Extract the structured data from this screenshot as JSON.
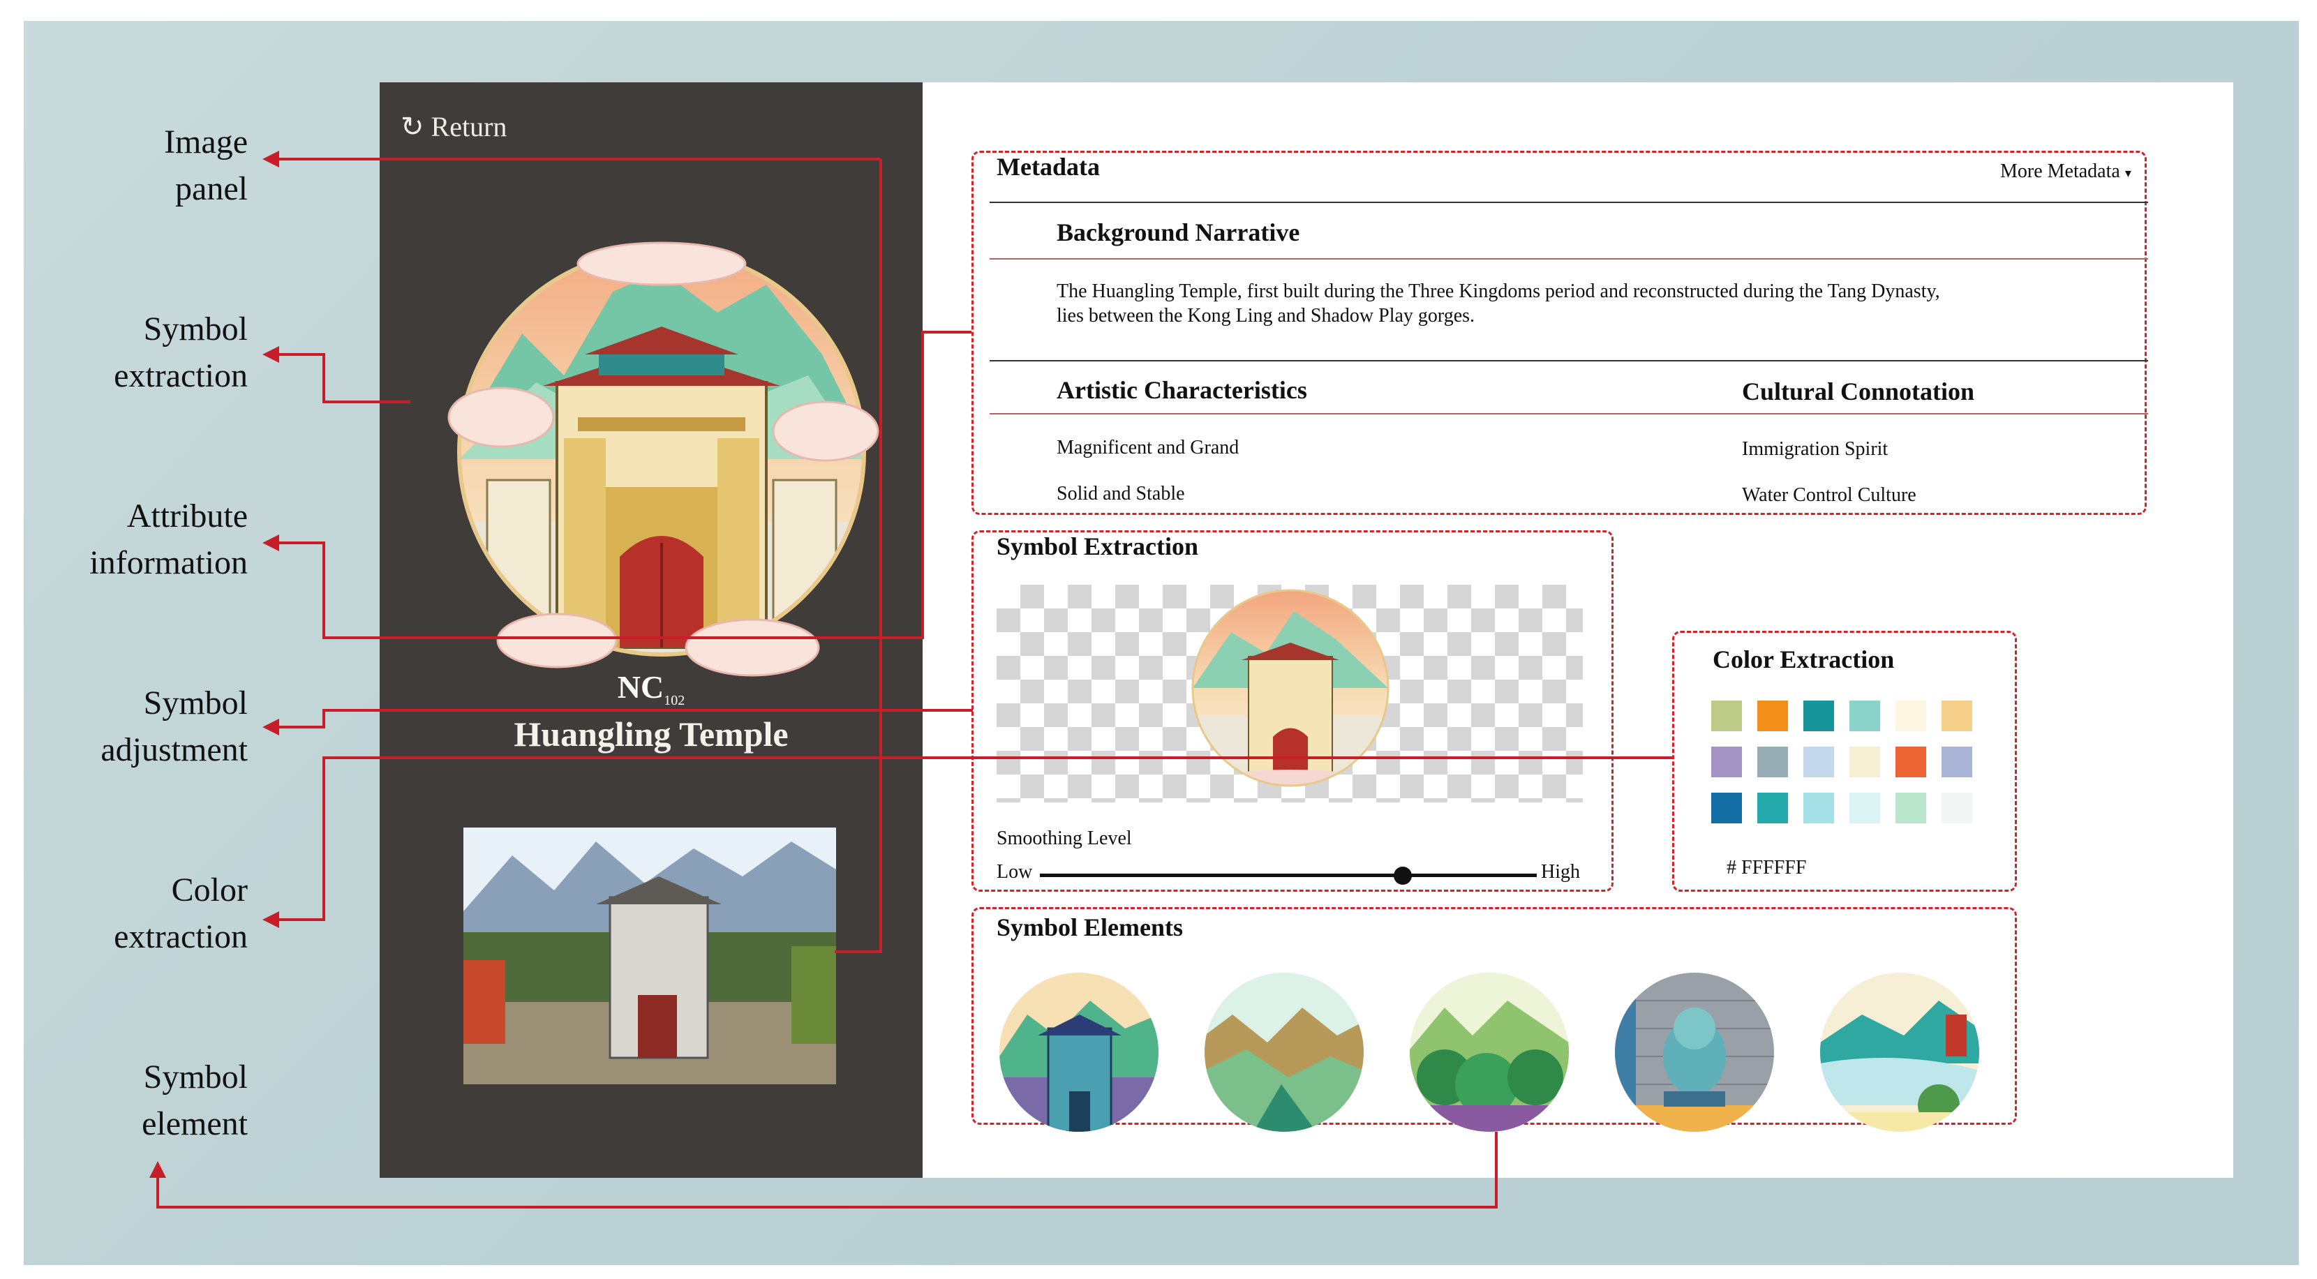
{
  "callouts": {
    "image_panel": [
      "Image",
      "panel"
    ],
    "symbol_extraction": [
      "Symbol",
      "extraction"
    ],
    "attribute_information": [
      "Attribute",
      "information"
    ],
    "symbol_adjustment": [
      "Symbol",
      "adjustment"
    ],
    "color_extraction": [
      "Color",
      "extraction"
    ],
    "symbol_element": [
      "Symbol",
      "element"
    ]
  },
  "left_panel": {
    "return_label": "Return",
    "code_main": "NC",
    "code_sub": "102",
    "name": "Huangling Temple"
  },
  "metadata": {
    "title": "Metadata",
    "more": "More Metadata",
    "background_title": "Background Narrative",
    "background_line1": "The Huangling Temple, first built during the Three Kingdoms period and reconstructed during the Tang Dynasty,",
    "background_line2": "lies between the Kong Ling and Shadow Play gorges.",
    "artistic_title": "Artistic Characteristics",
    "artistic_items": [
      "Magnificent and Grand",
      "Solid and Stable"
    ],
    "cultural_title": "Cultural Connotation",
    "cultural_items": [
      "Immigration Spirit",
      "Water Control Culture"
    ]
  },
  "symbol_extraction": {
    "title": "Symbol Extraction",
    "smoothing_label": "Smoothing Level",
    "low": "Low",
    "high": "High",
    "smoothing_value": 0.73
  },
  "color_extraction": {
    "title": "Color Extraction",
    "palette": [
      [
        "#bccc87",
        "#f28e1a",
        "#17959a",
        "#8ad3c8",
        "#fdf7e1",
        "#f6cf8a"
      ],
      [
        "#a494c6",
        "#97aeb6",
        "#c6d9ec",
        "#f5efd3",
        "#ec6434",
        "#a9b4d6"
      ],
      [
        "#126da4",
        "#24aaaa",
        "#a5e0e6",
        "#dcf3f3",
        "#b9e6cc",
        "#f2f7f6"
      ]
    ],
    "hex_value": "# FFFFFF"
  },
  "symbol_elements": {
    "title": "Symbol Elements",
    "items": [
      "temple-gate",
      "canyon",
      "forest",
      "guardian-lion",
      "river"
    ]
  },
  "colors": {
    "accent_red": "#d2232a",
    "panel_dark": "#403c39",
    "background": "#bcd1d4"
  }
}
